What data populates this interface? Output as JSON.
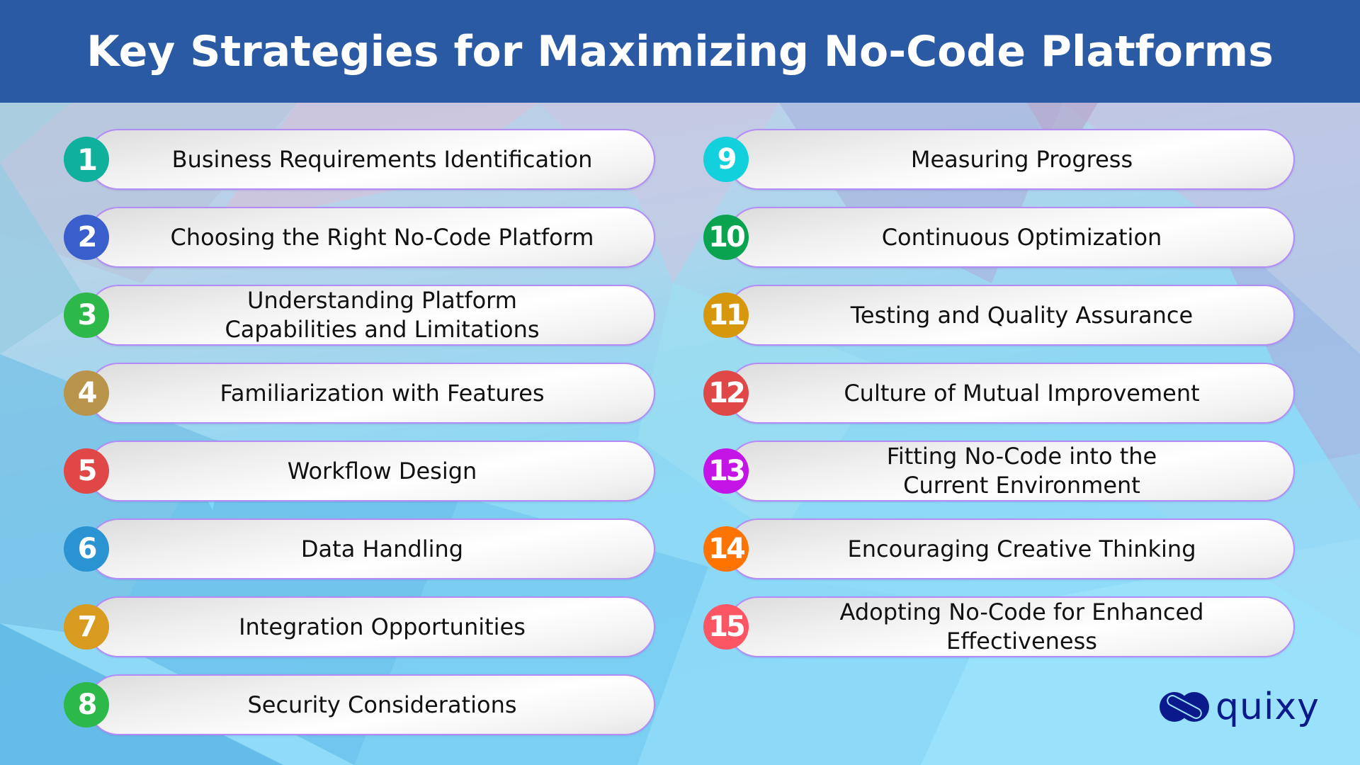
{
  "header": {
    "title": "Key Strategies for Maximizing No-Code Platforms",
    "background": "#2b5aa5"
  },
  "left_column": [
    {
      "number": "1",
      "label": "Business Requirements Identification",
      "color": "#0fb09c"
    },
    {
      "number": "2",
      "label": "Choosing the Right No-Code Platform",
      "color": "#3a5fcd"
    },
    {
      "number": "3",
      "label": "Understanding Platform\nCapabilities and Limitations",
      "color": "#2db84a"
    },
    {
      "number": "4",
      "label": "Familiarization with Features",
      "color": "#b8954a"
    },
    {
      "number": "5",
      "label": "Workflow Design",
      "color": "#e04848"
    },
    {
      "number": "6",
      "label": "Data Handling",
      "color": "#2a93d1"
    },
    {
      "number": "7",
      "label": "Integration Opportunities",
      "color": "#d89b1f"
    },
    {
      "number": "8",
      "label": "Security Considerations",
      "color": "#2db84a"
    }
  ],
  "right_column": [
    {
      "number": "9",
      "label": "Measuring Progress",
      "color": "#12d1dc"
    },
    {
      "number": "10",
      "label": "Continuous Optimization",
      "color": "#0aa34f"
    },
    {
      "number": "11",
      "label": "Testing and Quality Assurance",
      "color": "#d6970c"
    },
    {
      "number": "12",
      "label": "Culture of Mutual Improvement",
      "color": "#e04848"
    },
    {
      "number": "13",
      "label": "Fitting No-Code into the\nCurrent Environment",
      "color": "#c514e6"
    },
    {
      "number": "14",
      "label": "Encouraging Creative Thinking",
      "color": "#ff7300"
    },
    {
      "number": "15",
      "label": "Adopting No-Code for Enhanced\nEffectiveness",
      "color": "#fc5563"
    }
  ],
  "logo": {
    "text": "quixy",
    "color": "#0a1a8c"
  },
  "colors": {
    "pill_border": "#b48cf5",
    "text": "#111111"
  }
}
